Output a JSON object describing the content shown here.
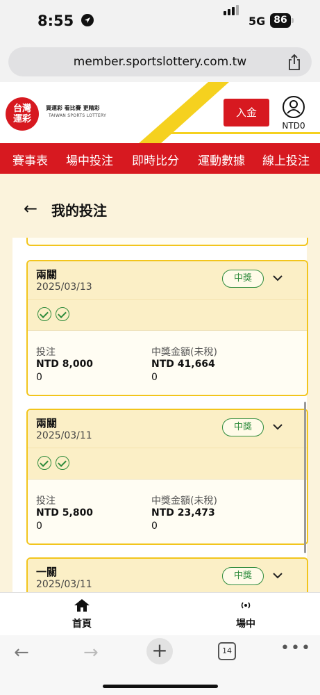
{
  "status_bar": {
    "time": "8:55",
    "network": "5G",
    "battery": "86"
  },
  "browser": {
    "url": "member.sportslottery.com.tw",
    "tab_count": "14"
  },
  "site": {
    "logo_text": [
      "台灣",
      "運彩"
    ],
    "tagline": "買運彩  看比賽  更精彩",
    "tagline_en": "TAIWAN SPORTS LOTTERY",
    "deposit_label": "入金",
    "balance": "NTD0",
    "accent_red": "#d71920",
    "accent_yellow": "#f2c51d"
  },
  "nav": {
    "items": [
      "賽事表",
      "場中投注",
      "即時比分",
      "運動數據",
      "線上投注"
    ]
  },
  "page": {
    "back_icon": "←",
    "title": "我的投注"
  },
  "bets": [
    {
      "type": "兩關",
      "date": "2025/03/13",
      "status": "中獎",
      "checks": 2,
      "stake_label": "投注",
      "stake": "NTD 8,000",
      "stake_sub": "0",
      "prize_label": "中獎金額(未稅)",
      "prize": "NTD 41,664",
      "prize_sub": "0"
    },
    {
      "type": "兩關",
      "date": "2025/03/11",
      "status": "中獎",
      "checks": 2,
      "stake_label": "投注",
      "stake": "NTD 5,800",
      "stake_sub": "0",
      "prize_label": "中獎金額(未稅)",
      "prize": "NTD 23,473",
      "prize_sub": "0"
    },
    {
      "type": "一關",
      "date": "2025/03/11",
      "status": "中獎"
    }
  ],
  "tabbar": {
    "home_label": "首頁",
    "live_label": "場中"
  }
}
